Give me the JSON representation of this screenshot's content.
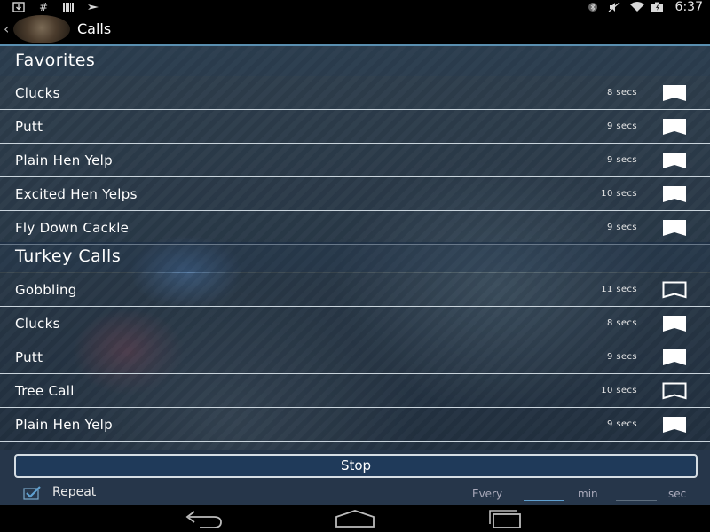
{
  "status_bar": {
    "left_icons": [
      "download-icon",
      "hash-icon",
      "barcode-icon",
      "airplane-icon"
    ],
    "right_icons": [
      "bluetooth-icon",
      "mute-icon",
      "wifi-icon",
      "battery-icon"
    ],
    "time": "6:37"
  },
  "action_bar": {
    "title": "Calls"
  },
  "sections": [
    {
      "title": "Favorites",
      "items": [
        {
          "name": "Clucks",
          "duration": "8 secs",
          "favorite": true
        },
        {
          "name": "Putt",
          "duration": "9 secs",
          "favorite": true
        },
        {
          "name": "Plain Hen Yelp",
          "duration": "9 secs",
          "favorite": true
        },
        {
          "name": "Excited Hen Yelps",
          "duration": "10 secs",
          "favorite": true
        },
        {
          "name": "Fly Down Cackle",
          "duration": "9 secs",
          "favorite": true
        }
      ]
    },
    {
      "title": "Turkey Calls",
      "items": [
        {
          "name": "Gobbling",
          "duration": "11 secs",
          "favorite": false
        },
        {
          "name": "Clucks",
          "duration": "8 secs",
          "favorite": true
        },
        {
          "name": "Putt",
          "duration": "9 secs",
          "favorite": true
        },
        {
          "name": "Tree Call",
          "duration": "10 secs",
          "favorite": false
        },
        {
          "name": "Plain Hen Yelp",
          "duration": "9 secs",
          "favorite": true
        }
      ]
    }
  ],
  "controls": {
    "stop_label": "Stop",
    "repeat_label": "Repeat",
    "repeat_checked": true,
    "every_label": "Every",
    "min_value": "",
    "min_label": "min",
    "sec_value": "",
    "sec_label": "sec"
  },
  "nav_bar": {
    "buttons": [
      "back-icon",
      "home-icon",
      "recents-icon"
    ]
  },
  "colors": {
    "accent": "#5fa0d0",
    "list_overlay": "#142640",
    "divider": "#c9d4dc"
  }
}
